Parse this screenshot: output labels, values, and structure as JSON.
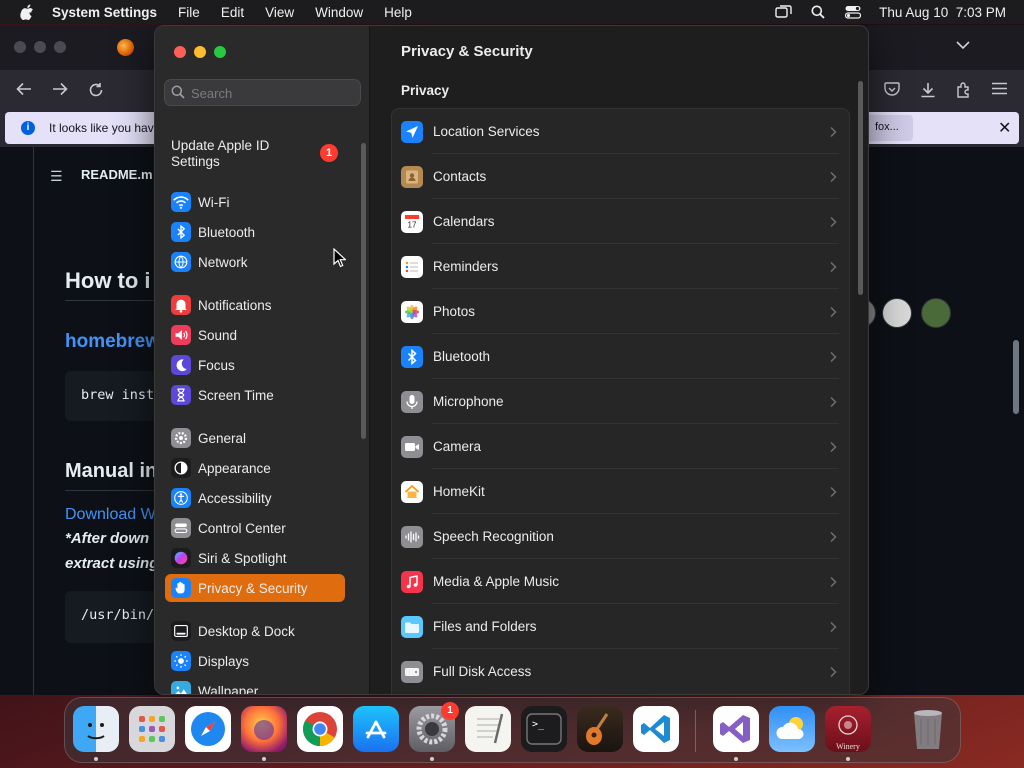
{
  "menubar": {
    "app_name": "System Settings",
    "menus": [
      "File",
      "Edit",
      "View",
      "Window",
      "Help"
    ],
    "datetime": "Thu Aug 10  7:03 PM"
  },
  "browser": {
    "notice_text": "It looks like you have",
    "notice_button": "fox...",
    "readme_label": "README.m",
    "heading_1": "How to i",
    "link_1": "homebrew",
    "code_1": "brew inst",
    "heading_2": "Manual in",
    "link_2": "Download W",
    "italic_1": "*After down",
    "italic_2": "extract using",
    "code_2": "/usr/bin/"
  },
  "settings": {
    "search_placeholder": "Search",
    "apple_id_label": "Update Apple ID Settings",
    "apple_id_badge": "1",
    "sidebar": {
      "groups": [
        [
          {
            "label": "Wi-Fi",
            "icon": "wifi-icon",
            "color": "#1a82fb"
          },
          {
            "label": "Bluetooth",
            "icon": "bluetooth-icon",
            "color": "#1a82fb"
          },
          {
            "label": "Network",
            "icon": "globe-icon",
            "color": "#1a82fb"
          }
        ],
        [
          {
            "label": "Notifications",
            "icon": "bell-icon",
            "color": "#ee3d3d"
          },
          {
            "label": "Sound",
            "icon": "speaker-icon",
            "color": "#ee3d5a"
          },
          {
            "label": "Focus",
            "icon": "moon-icon",
            "color": "#5c48d9"
          },
          {
            "label": "Screen Time",
            "icon": "hourglass-icon",
            "color": "#5c48d9"
          }
        ],
        [
          {
            "label": "General",
            "icon": "gear-icon",
            "color": "#8e8e93"
          },
          {
            "label": "Appearance",
            "icon": "appearance-icon",
            "color": "#1c1c1e"
          },
          {
            "label": "Accessibility",
            "icon": "accessibility-icon",
            "color": "#1a82fb"
          },
          {
            "label": "Control Center",
            "icon": "control-center-icon",
            "color": "#8e8e93"
          },
          {
            "label": "Siri & Spotlight",
            "icon": "siri-icon",
            "color": "#3b2d6e"
          },
          {
            "label": "Privacy & Security",
            "icon": "hand-icon",
            "color": "#1a82fb",
            "selected": true
          }
        ],
        [
          {
            "label": "Desktop & Dock",
            "icon": "dock-icon",
            "color": "#1c1c1e"
          },
          {
            "label": "Displays",
            "icon": "sun-icon",
            "color": "#1a82fb"
          },
          {
            "label": "Wallpaper",
            "icon": "wallpaper-icon",
            "color": "#36a9e1"
          }
        ]
      ]
    },
    "main": {
      "title": "Privacy & Security",
      "section": "Privacy",
      "rows": [
        {
          "label": "Location Services",
          "icon": "location-arrow-icon",
          "color": "#1a82fb"
        },
        {
          "label": "Contacts",
          "icon": "contacts-icon",
          "color": "#b58a52"
        },
        {
          "label": "Calendars",
          "icon": "calendar-icon",
          "color": "#ffffff"
        },
        {
          "label": "Reminders",
          "icon": "reminders-icon",
          "color": "#ffffff"
        },
        {
          "label": "Photos",
          "icon": "photos-icon",
          "color": "#ffffff"
        },
        {
          "label": "Bluetooth",
          "icon": "bluetooth-icon",
          "color": "#1a82fb"
        },
        {
          "label": "Microphone",
          "icon": "microphone-icon",
          "color": "#8e8e93"
        },
        {
          "label": "Camera",
          "icon": "camera-icon",
          "color": "#8e8e93"
        },
        {
          "label": "HomeKit",
          "icon": "home-icon",
          "color": "#ffffff"
        },
        {
          "label": "Speech Recognition",
          "icon": "waveform-icon",
          "color": "#8e8e93"
        },
        {
          "label": "Media & Apple Music",
          "icon": "music-note-icon",
          "color": "#f5344c"
        },
        {
          "label": "Files and Folders",
          "icon": "folder-icon",
          "color": "#5ac8fa"
        },
        {
          "label": "Full Disk Access",
          "icon": "disk-icon",
          "color": "#8e8e93"
        }
      ]
    }
  },
  "dock": {
    "apps": [
      "Finder",
      "Launchpad",
      "Safari",
      "Firefox",
      "Chrome",
      "App Store",
      "System Settings",
      "TextEdit",
      "Terminal",
      "GarageBand",
      "Visual Studio Code",
      "Visual Studio",
      "Weather",
      "Winery",
      "Trash"
    ],
    "settings_badge": "1",
    "winery_label": "Winery"
  }
}
